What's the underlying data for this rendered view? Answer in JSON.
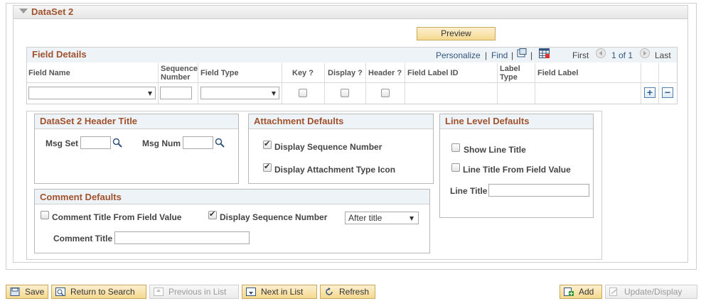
{
  "dataset": {
    "title": "DataSet 2",
    "preview_label": "Preview"
  },
  "grid": {
    "title": "Field Details",
    "personalize": "Personalize",
    "sep1": "|",
    "find": "Find",
    "sep2": "|",
    "sep3": "|",
    "first": "First",
    "range": "1 of 1",
    "last": "Last",
    "columns": {
      "field_name": "Field Name",
      "sequence_number": [
        "Sequence",
        "Number"
      ],
      "field_type": "Field Type",
      "key": "Key ?",
      "display": "Display ?",
      "header": "Header ?",
      "field_label_id": "Field Label ID",
      "label_type": [
        "Label",
        "Type"
      ],
      "field_label": "Field Label"
    },
    "row": {
      "field_name": "",
      "sequence": "",
      "field_type": "",
      "key": false,
      "display": false,
      "header": false
    }
  },
  "header_title_panel": {
    "title": "DataSet 2 Header Title",
    "msg_set_label": "Msg Set",
    "msg_set_value": "",
    "msg_num_label": "Msg Num",
    "msg_num_value": ""
  },
  "attachment_panel": {
    "title": "Attachment Defaults",
    "display_sequence_label": "Display Sequence Number",
    "display_sequence_checked": true,
    "display_icon_label": "Display Attachment Type Icon",
    "display_icon_checked": true
  },
  "line_panel": {
    "title": "Line Level Defaults",
    "show_line_title_label": "Show Line Title",
    "show_line_title_checked": false,
    "line_title_from_field_label": "Line Title From Field Value",
    "line_title_from_field_checked": false,
    "line_title_label": "Line Title",
    "line_title_value": ""
  },
  "comment_panel": {
    "title": "Comment Defaults",
    "comment_title_from_field_label": "Comment Title From Field Value",
    "comment_title_from_field_checked": false,
    "display_sequence_label": "Display Sequence Number",
    "display_sequence_checked": true,
    "position_value": "After title",
    "comment_title_label": "Comment Title",
    "comment_title_value": ""
  },
  "toolbar": {
    "save": "Save",
    "return_to_search": "Return to Search",
    "previous_in_list": "Previous in List",
    "next_in_list": "Next in List",
    "refresh": "Refresh",
    "add": "Add",
    "update_display": "Update/Display"
  }
}
